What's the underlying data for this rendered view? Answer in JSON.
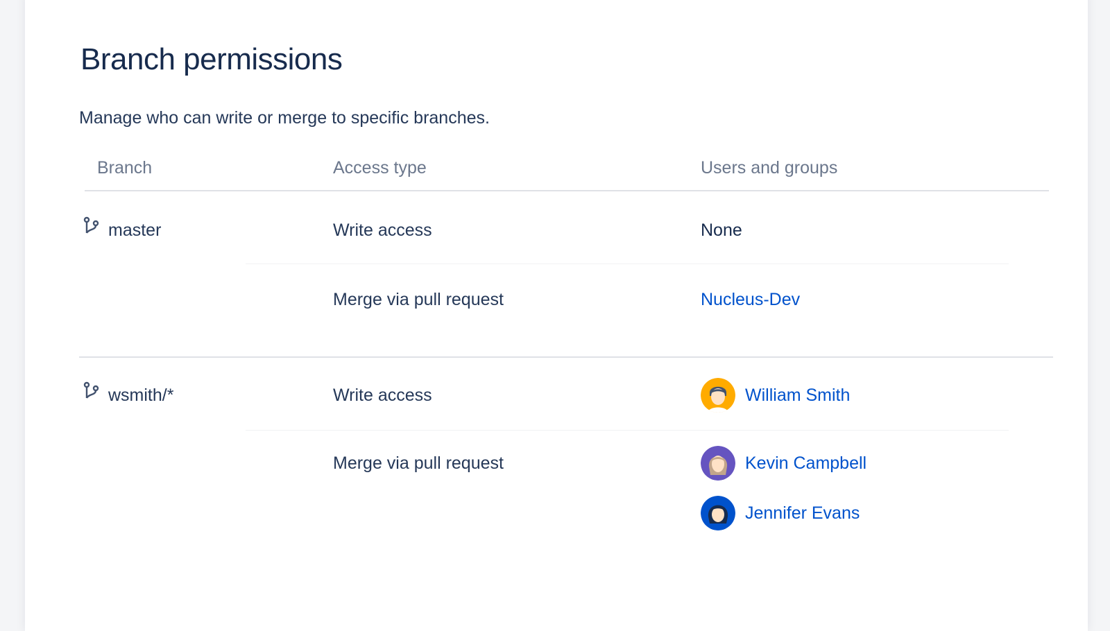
{
  "page": {
    "title": "Branch permissions",
    "description": "Manage who can write or merge to specific branches."
  },
  "table": {
    "headers": {
      "branch": "Branch",
      "access_type": "Access type",
      "users_and_groups": "Users and groups"
    },
    "branches": [
      {
        "name": "master",
        "icon": "branch-icon",
        "permissions": [
          {
            "access_type": "Write access",
            "value": "None"
          },
          {
            "access_type": "Merge via pull request",
            "group": "Nucleus-Dev"
          }
        ]
      },
      {
        "name": "wsmith/*",
        "icon": "branch-icon",
        "permissions": [
          {
            "access_type": "Write access",
            "users": [
              {
                "name": "William Smith",
                "avatar_color": "#ffab00"
              }
            ]
          },
          {
            "access_type": "Merge via pull request",
            "users": [
              {
                "name": "Kevin Campbell",
                "avatar_color": "#6554c0"
              },
              {
                "name": "Jennifer Evans",
                "avatar_color": "#0052cc"
              }
            ]
          }
        ]
      }
    ]
  },
  "colors": {
    "link": "#0052cc",
    "text": "#253858",
    "header_text": "#6b778c",
    "divider": "#dfe1e6"
  }
}
